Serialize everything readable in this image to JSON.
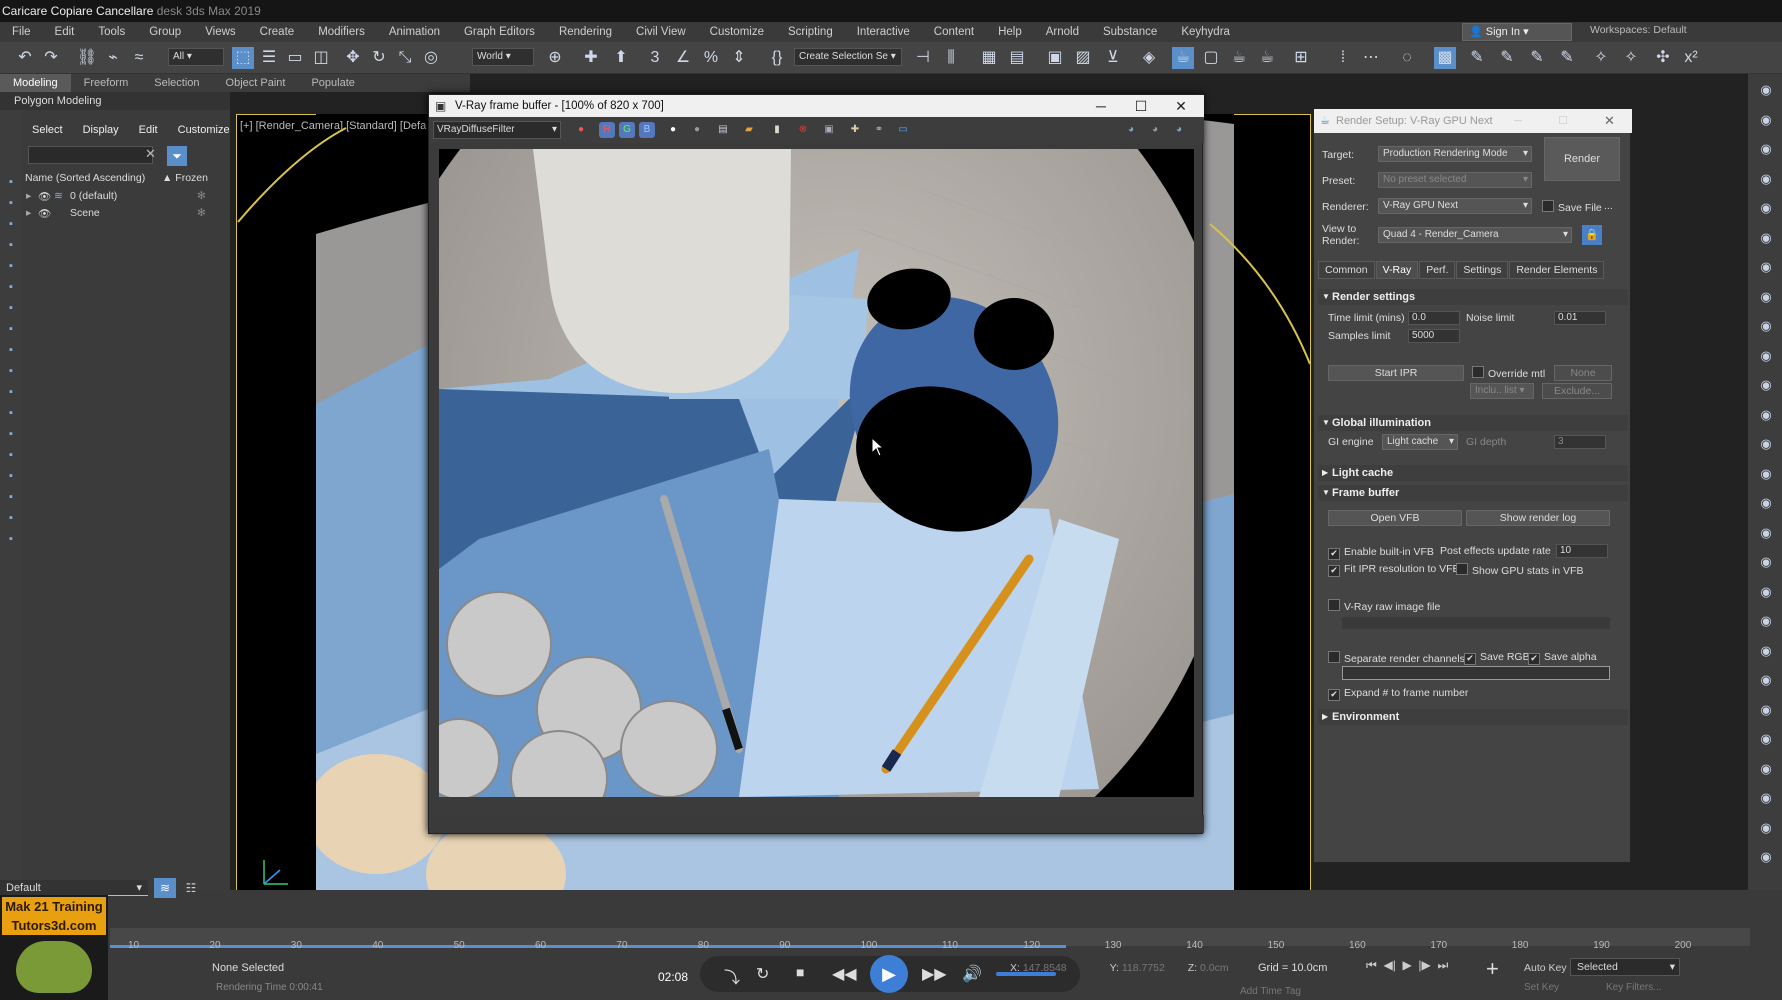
{
  "app": {
    "title": "Caricare Copiare Cancellare",
    "window_suffix": "desk 3ds Max 2019"
  },
  "menu": [
    "File",
    "Edit",
    "Tools",
    "Group",
    "Views",
    "Create",
    "Modifiers",
    "Animation",
    "Graph Editors",
    "Rendering",
    "Civil View",
    "Customize",
    "Scripting",
    "Interactive",
    "Content",
    "Help",
    "Arnold",
    "Substance",
    "Keyhydra"
  ],
  "account": {
    "signin": "Sign In",
    "workspaces_label": "Workspaces:",
    "workspace": "Default"
  },
  "toolbar": {
    "filter": "All",
    "refcoord": "World",
    "selset": "Create Selection Se"
  },
  "ribbon": {
    "tabs": [
      "Modeling",
      "Freeform",
      "Selection",
      "Object Paint",
      "Populate"
    ],
    "sub": "Polygon Modeling"
  },
  "scene_explorer": {
    "menu": [
      "Select",
      "Display",
      "Edit",
      "Customize"
    ],
    "col_name": "Name (Sorted Ascending)",
    "col_frozen": "▲ Frozen",
    "rows": [
      "0 (default)",
      "Scene"
    ],
    "layer": "Default"
  },
  "viewport": {
    "label": "[+] [Render_Camera] [Standard] [Defa"
  },
  "vfb": {
    "title": "V-Ray frame buffer - [100% of 820 x 700]",
    "filter": "VRayDiffuseFilter"
  },
  "render_setup": {
    "title": "Render Setup: V-Ray GPU Next",
    "target_label": "Target:",
    "target": "Production Rendering Mode",
    "preset_label": "Preset:",
    "preset": "No preset selected",
    "renderer_label": "Renderer:",
    "renderer": "V-Ray GPU Next",
    "savefile": "Save File",
    "ellipsis": "...",
    "view_label": "View to Render:",
    "view": "Quad 4 - Render_Camera",
    "render_btn": "Render",
    "tabs": [
      "Common",
      "V-Ray",
      "Perf.",
      "Settings",
      "Render Elements"
    ],
    "render_settings": "Render settings",
    "time_limit_label": "Time limit (mins)",
    "time_limit": "0.0",
    "noise_limit_label": "Noise limit",
    "noise_limit": "0.01",
    "samples_label": "Samples limit",
    "samples": "5000",
    "start_ipr": "Start IPR",
    "override_mtl": "Override mtl",
    "none": "None",
    "inclu": "Inclu.. list",
    "exclude": "Exclude...",
    "gi": "Global illumination",
    "gi_engine_label": "GI engine",
    "gi_engine": "Light cache",
    "gi_depth_label": "GI depth",
    "gi_depth": "3",
    "light_cache": "Light cache",
    "frame_buffer": "Frame buffer",
    "open_vfb": "Open VFB",
    "show_log": "Show render log",
    "enable_vfb": "Enable built-in VFB",
    "post_rate_label": "Post effects update rate",
    "post_rate": "10",
    "fit_ipr": "Fit IPR resolution to VFB",
    "gpu_stats": "Show GPU stats in VFB",
    "raw": "V-Ray raw image file",
    "sep_channels": "Separate render channels",
    "save_rgb": "Save RGB",
    "save_alpha": "Save alpha",
    "expand": "Expand # to frame number",
    "environment": "Environment"
  },
  "timeline": {
    "ticks": [
      "10",
      "20",
      "30",
      "40",
      "50",
      "60",
      "70",
      "80",
      "90",
      "100",
      "110",
      "120",
      "130",
      "140",
      "150",
      "160",
      "170",
      "180",
      "190",
      "200"
    ]
  },
  "status": {
    "selection": "None Selected",
    "render_time": "Rendering Time 0:00:41",
    "clock": "02:08",
    "x_label": "X:",
    "x": "147.8548",
    "y_label": "Y:",
    "y": "118.7752",
    "z_label": "Z:",
    "z": "0.0cm",
    "grid": "Grid = 10.0cm",
    "autokey": "Auto Key",
    "selected": "Selected",
    "setkey": "Set Key",
    "keyfilters": "Key Filters...",
    "addtimetag": "Add Time Tag"
  },
  "logo": {
    "line1": "Mak 21 Training",
    "line2": "Tutors3d.com"
  },
  "colors": {
    "accent": "#3d7fd6",
    "viewport_border": "#d8c24a"
  }
}
